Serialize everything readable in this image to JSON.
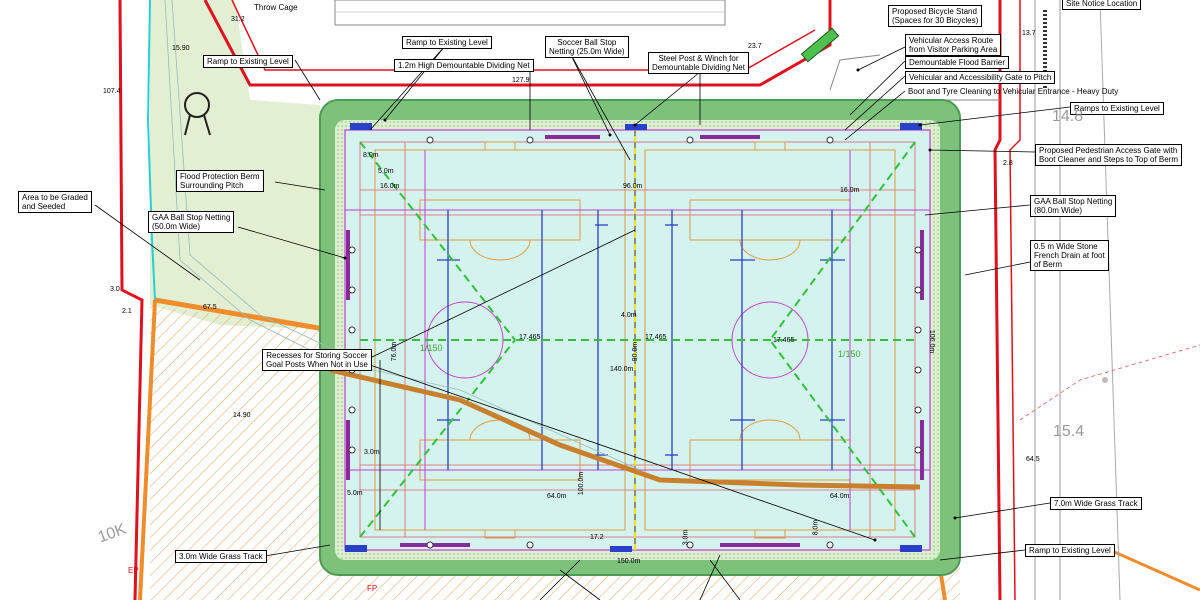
{
  "colors": {
    "berm_green": "#7cc27a",
    "berm_dark": "#4f9a55",
    "pitch_fill": "#d5f3ee",
    "site_boundary": "#e0101e",
    "hatch": "#e89a4a",
    "net_magenta": "#c23ed0",
    "grass_track": "#eef6df"
  },
  "labels": {
    "throw_cage": "Throw Cage",
    "ramp_existing_top": "Ramp to Existing Level",
    "ramp_existing_left": "Ramp to Existing Level",
    "dividing_net": "1.2m High Demountable Dividing Net",
    "soccer_netting": [
      "Soccer Ball Stop",
      "Netting (25.0m Wide)"
    ],
    "steel_post": [
      "Steel Post & Winch for",
      "Demountable Dividing Net"
    ],
    "bicycle_stand": [
      "Proposed Bicycle Stand",
      "(Spaces for 30 Bicycles)"
    ],
    "vehicular_route": [
      "Vehicular Access Route",
      "from Visitor Parking Area"
    ],
    "flood_barrier": "Demountable Flood Barrier",
    "vehicular_gate": "Vehicular and Accessibility Gate to Pitch",
    "boot_tyre": "Boot and Tyre Cleaning to Vehicular Entrance - Heavy Duty",
    "ramps_existing_right": "Ramps to Existing Level",
    "pedestrian_gate": [
      "Proposed Pedestrian Access Gate with",
      "Boot Cleaner and Steps to Top of Berm"
    ],
    "site_notice": "Site Notice Location",
    "area_graded": [
      "Area to be Graded",
      "and Seeded"
    ],
    "flood_berm": [
      "Flood Protection Berm",
      "Surrounding Pitch"
    ],
    "gaa_netting_left": [
      "GAA Ball Stop Netting",
      "(50.0m Wide)"
    ],
    "gaa_netting_right": [
      "GAA Ball Stop Netting",
      "(80.0m Wide)"
    ],
    "french_drain": [
      "0.5 m Wide Stone",
      "French Drain at foot",
      "of Berm"
    ],
    "recesses": [
      "Recesses for Storing Soccer",
      "Goal Posts When Not in Use"
    ],
    "grass_track_left": "3.0m Wide Grass Track",
    "grass_track_right": "7.0m Wide Grass Track",
    "ramp_bottom_right": "Ramp to Existing Level"
  },
  "dimensions": {
    "d96": "96.0m",
    "d16_left": "16.0m",
    "d16_right": "16.0m",
    "d8_tl": "8.0m",
    "d5_tl": "5.0m",
    "d5_bl": "5.0m",
    "d3_l": "3.0m",
    "d64_left": "64.0m",
    "d64_right": "64.0m",
    "d140": "140.0m",
    "d150": "150.0m",
    "d100": "100.0m",
    "d76": "76.0m",
    "d106": "106.0m",
    "d90": "90.0m",
    "d4": "4.0m",
    "d8_br": "8.0m",
    "d3_b": "3.0m",
    "d2": "2.8",
    "slope_left": "1/150",
    "slope_right": "1/150",
    "lvl_17465_a": "17.465",
    "lvl_17465_b": "17.465",
    "lvl_17465_c": "17.465"
  },
  "spot_levels": {
    "s312": "31.2",
    "s237": "23.7",
    "s279": "127.9",
    "s1574": "107.4",
    "s675": "67.5",
    "s30": "3.0",
    "s1487": "14.8",
    "s154": "15.4",
    "s137": "13.7",
    "s645": "64.5",
    "s1590": "15.90",
    "s1490": "14.90",
    "s17": "17.2",
    "s2r": "2.1",
    "s10k": "10K"
  },
  "markers": {
    "fp_left": "FP",
    "fp_bottom": "FP",
    "ep": "EP"
  }
}
